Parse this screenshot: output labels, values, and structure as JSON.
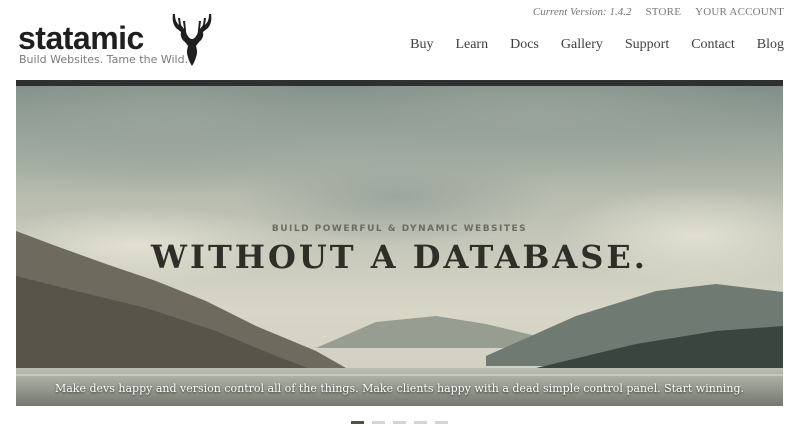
{
  "logo": {
    "text": "statamic",
    "tagline": "Build Websites. Tame the Wild."
  },
  "topbar": {
    "version_label": "Current Version: 1.4.2",
    "links": [
      "STORE",
      "YOUR ACCOUNT"
    ]
  },
  "nav": {
    "items": [
      "Buy",
      "Learn",
      "Docs",
      "Gallery",
      "Support",
      "Contact",
      "Blog"
    ]
  },
  "hero": {
    "kicker": "BUILD POWERFUL & DYNAMIC WEBSITES",
    "title": "WITHOUT A DATABASE.",
    "subtitle": "Make devs happy and version control all of the things. Make clients happy with a dead simple control panel. Start winning."
  },
  "slider": {
    "count": 5,
    "active_index": 0
  },
  "colors": {
    "brand_dark": "#1f1f1f",
    "active_dot": "#55533f",
    "inactive_dot": "#d5d5d5"
  }
}
